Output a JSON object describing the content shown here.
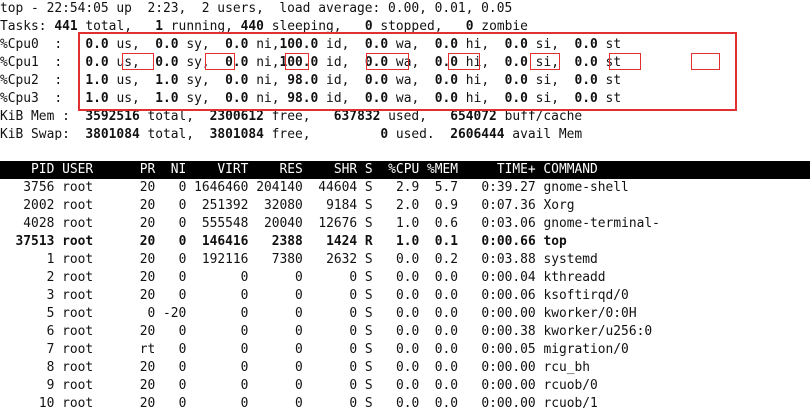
{
  "summary": {
    "uptime_line": "top - 22:54:05 up  2:23,  2 users,  load average: 0.00, 0.01, 0.05",
    "tasks": {
      "label": "Tasks:",
      "total": "441",
      "total_label": " total,",
      "running": "1",
      "running_label": " running,",
      "sleeping": "440",
      "sleeping_label": " sleeping,",
      "stopped": "0",
      "stopped_label": " stopped,",
      "zombie": "0",
      "zombie_label": " zombie"
    },
    "cpus": [
      {
        "label": "%Cpu0  :",
        "us": "0.0",
        "sy": "0.0",
        "ni": "0.0",
        "id": "100.0",
        "wa": "0.0",
        "hi": "0.0",
        "si": "0.0",
        "st": "0.0"
      },
      {
        "label": "%Cpu1  :",
        "us": "0.0",
        "sy": "0.0",
        "ni": "0.0",
        "id": "100.0",
        "wa": "0.0",
        "hi": "0.0",
        "si": "0.0",
        "st": "0.0"
      },
      {
        "label": "%Cpu2  :",
        "us": "1.0",
        "sy": "1.0",
        "ni": "0.0",
        "id": "98.0",
        "wa": "0.0",
        "hi": "0.0",
        "si": "0.0",
        "st": "0.0"
      },
      {
        "label": "%Cpu3  :",
        "us": "1.0",
        "sy": "1.0",
        "ni": "0.0",
        "id": "98.0",
        "wa": "0.0",
        "hi": "0.0",
        "si": "0.0",
        "st": "0.0"
      }
    ],
    "cpu_field_labels": {
      "us": " us,",
      "sy": " sy,",
      "ni": " ni,",
      "id": " id,",
      "wa": " wa,",
      "hi": " hi,",
      "si": " si,",
      "st": " st"
    },
    "mem": {
      "label": "KiB Mem :",
      "total": "3592516",
      "total_label": " total,",
      "free": "2300612",
      "free_label": " free,",
      "used": "637832",
      "used_label": " used,",
      "buff": "654072",
      "buff_label": " buff/cache"
    },
    "swap": {
      "label": "KiB Swap:",
      "total": "3801084",
      "total_label": " total,",
      "free": "3801084",
      "free_label": " free,",
      "used": "0",
      "used_label": " used.",
      "avail": "2606444",
      "avail_label": " avail Mem"
    }
  },
  "table": {
    "headers": {
      "pid": "PID",
      "user": "USER",
      "pr": "PR",
      "ni": "NI",
      "virt": "VIRT",
      "res": "RES",
      "shr": "SHR",
      "s": "S",
      "cpu": "%CPU",
      "mem": "%MEM",
      "time": "TIME+",
      "command": "COMMAND"
    },
    "rows": [
      {
        "pid": "3756",
        "user": "root",
        "pr": "20",
        "ni": "0",
        "virt": "1646460",
        "res": "204140",
        "shr": "44604",
        "s": "S",
        "cpu": "2.9",
        "mem": "5.7",
        "time": "0:39.27",
        "command": "gnome-shell",
        "bold": false
      },
      {
        "pid": "2002",
        "user": "root",
        "pr": "20",
        "ni": "0",
        "virt": "251392",
        "res": "32080",
        "shr": "9184",
        "s": "S",
        "cpu": "2.0",
        "mem": "0.9",
        "time": "0:07.36",
        "command": "Xorg",
        "bold": false
      },
      {
        "pid": "4028",
        "user": "root",
        "pr": "20",
        "ni": "0",
        "virt": "555548",
        "res": "20040",
        "shr": "12676",
        "s": "S",
        "cpu": "1.0",
        "mem": "0.6",
        "time": "0:03.06",
        "command": "gnome-terminal-",
        "bold": false
      },
      {
        "pid": "37513",
        "user": "root",
        "pr": "20",
        "ni": "0",
        "virt": "146416",
        "res": "2388",
        "shr": "1424",
        "s": "R",
        "cpu": "1.0",
        "mem": "0.1",
        "time": "0:00.66",
        "command": "top",
        "bold": true
      },
      {
        "pid": "1",
        "user": "root",
        "pr": "20",
        "ni": "0",
        "virt": "192116",
        "res": "7380",
        "shr": "2632",
        "s": "S",
        "cpu": "0.0",
        "mem": "0.2",
        "time": "0:03.88",
        "command": "systemd",
        "bold": false
      },
      {
        "pid": "2",
        "user": "root",
        "pr": "20",
        "ni": "0",
        "virt": "0",
        "res": "0",
        "shr": "0",
        "s": "S",
        "cpu": "0.0",
        "mem": "0.0",
        "time": "0:00.04",
        "command": "kthreadd",
        "bold": false
      },
      {
        "pid": "3",
        "user": "root",
        "pr": "20",
        "ni": "0",
        "virt": "0",
        "res": "0",
        "shr": "0",
        "s": "S",
        "cpu": "0.0",
        "mem": "0.0",
        "time": "0:00.06",
        "command": "ksoftirqd/0",
        "bold": false
      },
      {
        "pid": "5",
        "user": "root",
        "pr": "0",
        "ni": "-20",
        "virt": "0",
        "res": "0",
        "shr": "0",
        "s": "S",
        "cpu": "0.0",
        "mem": "0.0",
        "time": "0:00.00",
        "command": "kworker/0:0H",
        "bold": false
      },
      {
        "pid": "6",
        "user": "root",
        "pr": "20",
        "ni": "0",
        "virt": "0",
        "res": "0",
        "shr": "0",
        "s": "S",
        "cpu": "0.0",
        "mem": "0.0",
        "time": "0:00.38",
        "command": "kworker/u256:0",
        "bold": false
      },
      {
        "pid": "7",
        "user": "root",
        "pr": "rt",
        "ni": "0",
        "virt": "0",
        "res": "0",
        "shr": "0",
        "s": "S",
        "cpu": "0.0",
        "mem": "0.0",
        "time": "0:00.05",
        "command": "migration/0",
        "bold": false
      },
      {
        "pid": "8",
        "user": "root",
        "pr": "20",
        "ni": "0",
        "virt": "0",
        "res": "0",
        "shr": "0",
        "s": "S",
        "cpu": "0.0",
        "mem": "0.0",
        "time": "0:00.00",
        "command": "rcu_bh",
        "bold": false
      },
      {
        "pid": "9",
        "user": "root",
        "pr": "20",
        "ni": "0",
        "virt": "0",
        "res": "0",
        "shr": "0",
        "s": "S",
        "cpu": "0.0",
        "mem": "0.0",
        "time": "0:00.00",
        "command": "rcuob/0",
        "bold": false
      },
      {
        "pid": "10",
        "user": "root",
        "pr": "20",
        "ni": "0",
        "virt": "0",
        "res": "0",
        "shr": "0",
        "s": "S",
        "cpu": "0.0",
        "mem": "0.0",
        "time": "0:00.00",
        "command": "rcuob/1",
        "bold": false
      }
    ]
  },
  "highlight_color": "#e03030"
}
